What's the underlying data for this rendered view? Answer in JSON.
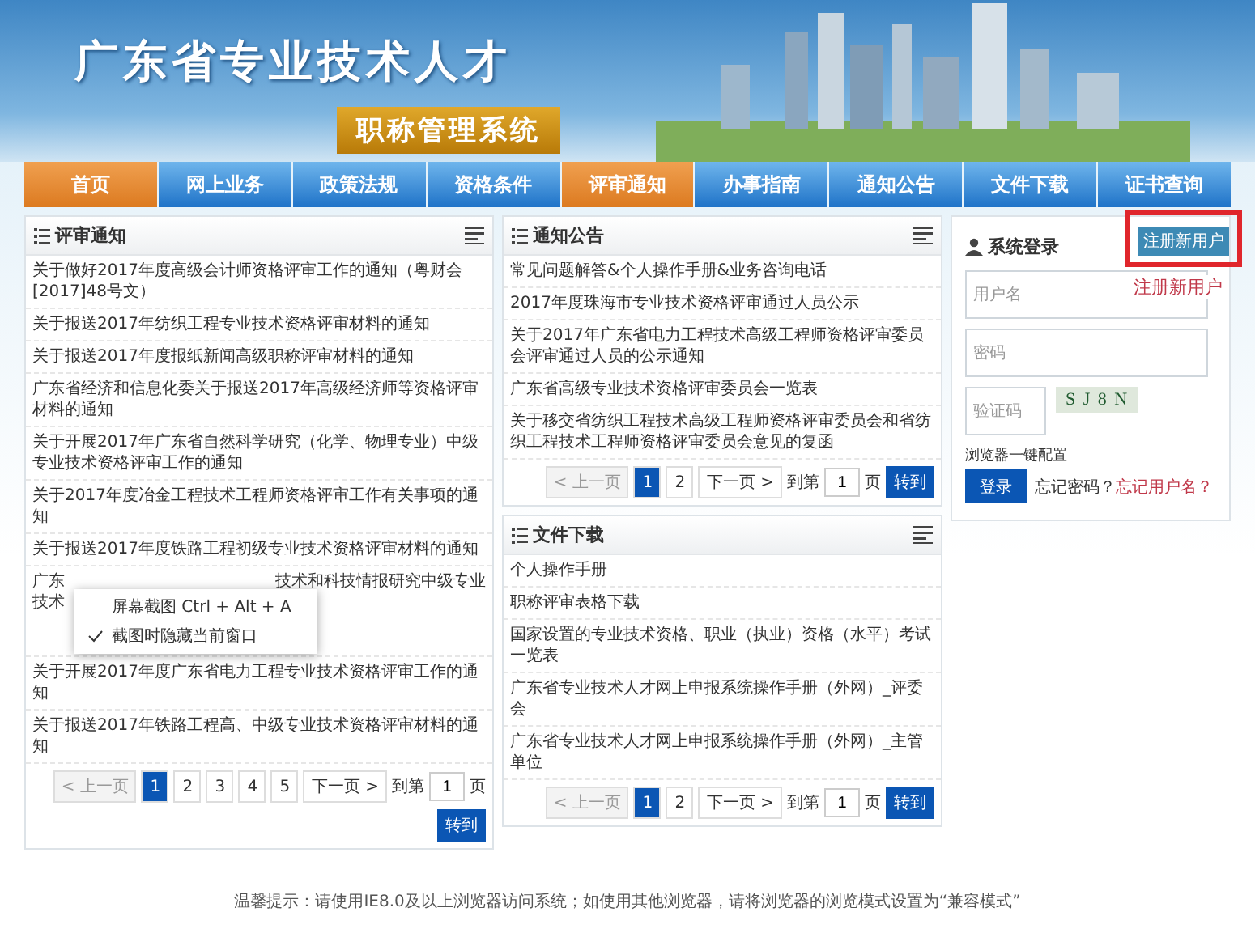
{
  "header": {
    "title": "广东省专业技术人才",
    "subtitle": "职称管理系统"
  },
  "nav": [
    {
      "label": "首页",
      "selected": true
    },
    {
      "label": "网上业务",
      "selected": false
    },
    {
      "label": "政策法规",
      "selected": false
    },
    {
      "label": "资格条件",
      "selected": false
    },
    {
      "label": "评审通知",
      "selected": true
    },
    {
      "label": "办事指南",
      "selected": false
    },
    {
      "label": "通知公告",
      "selected": false
    },
    {
      "label": "文件下载",
      "selected": false
    },
    {
      "label": "证书查询",
      "selected": false
    }
  ],
  "review_notices": {
    "title": "评审通知",
    "items": [
      {
        "kind": "full",
        "text": "关于做好2017年度高级会计师资格评审工作的通知（粤财会[2017]48号文）"
      },
      {
        "kind": "full",
        "text": "关于报送2017年纺织工程专业技术资格评审材料的通知"
      },
      {
        "kind": "full",
        "text": "关于报送2017年度报纸新闻高级职称评审材料的通知"
      },
      {
        "kind": "full",
        "text": "广东省经济和信息化委关于报送2017年高级经济师等资格评审材料的通知"
      },
      {
        "kind": "full",
        "text": "关于开展2017年广东省自然科学研究（化学、物理专业）中级专业技术资格评审工作的通知"
      },
      {
        "kind": "full",
        "text": "关于2017年度冶金工程技术工程师资格评审工作有关事项的通知"
      },
      {
        "kind": "full",
        "text": "关于报送2017年度铁路工程初级专业技术资格评审材料的通知"
      },
      {
        "kind": "covered",
        "lines": [
          {
            "left": "广东",
            "right": "技术和科技情报研究中级专业"
          },
          {
            "left": "技术"
          }
        ]
      },
      {
        "kind": "full",
        "text": "关于开展2017年度广东省电力工程专业技术资格评审工作的通知"
      },
      {
        "kind": "full",
        "text": "关于报送2017年铁路工程高、中级专业技术资格评审材料的通知"
      }
    ],
    "pager": {
      "prev": "< 上一页",
      "pages": [
        {
          "label": "1",
          "selected": true
        },
        {
          "label": "2",
          "selected": false
        },
        {
          "label": "3",
          "selected": false
        },
        {
          "label": "4",
          "selected": false
        },
        {
          "label": "5",
          "selected": false
        }
      ],
      "next": "下一页 >",
      "goto_label": "到第",
      "page_value": "1",
      "page_unit": "页",
      "goto_button": "转到"
    }
  },
  "context_menu": [
    {
      "label": "屏幕截图 Ctrl + Alt + A",
      "checked": false
    },
    {
      "label": "截图时隐藏当前窗口",
      "checked": true
    }
  ],
  "announcements": {
    "title": "通知公告",
    "items": [
      {
        "kind": "full",
        "text": "常见问题解答&个人操作手册&业务咨询电话"
      },
      {
        "kind": "full",
        "text": "2017年度珠海市专业技术资格评审通过人员公示"
      },
      {
        "kind": "full",
        "text": "关于2017年广东省电力工程技术高级工程师资格评审委员会评审通过人员的公示通知"
      },
      {
        "kind": "full",
        "text": "广东省高级专业技术资格评审委员会一览表"
      },
      {
        "kind": "full",
        "text": "关于移交省纺织工程技术高级工程师资格评审委员会和省纺织工程技术工程师资格评审委员会意见的复函"
      }
    ],
    "pager": {
      "prev": "< 上一页",
      "pages": [
        {
          "label": "1",
          "selected": true
        },
        {
          "label": "2",
          "selected": false
        }
      ],
      "next": "下一页 >",
      "goto_label": "到第",
      "page_value": "1",
      "page_unit": "页",
      "goto_button": "转到"
    }
  },
  "downloads": {
    "title": "文件下载",
    "items": [
      {
        "kind": "full",
        "text": "个人操作手册"
      },
      {
        "kind": "full",
        "text": "职称评审表格下载"
      },
      {
        "kind": "full",
        "text": "国家设置的专业技术资格、职业（执业）资格（水平）考试一览表"
      },
      {
        "kind": "full",
        "text": "广东省专业技术人才网上申报系统操作手册（外网）_评委会"
      },
      {
        "kind": "full",
        "text": "广东省专业技术人才网上申报系统操作手册（外网）_主管单位"
      }
    ],
    "pager": {
      "prev": "< 上一页",
      "pages": [
        {
          "label": "1",
          "selected": true
        },
        {
          "label": "2",
          "selected": false
        }
      ],
      "next": "下一页 >",
      "goto_label": "到第",
      "page_value": "1",
      "page_unit": "页",
      "goto_button": "转到"
    }
  },
  "login": {
    "title": "系统登录",
    "register_button": "注册新用户",
    "annotation": "注册新用户",
    "username": {
      "placeholder": "用户名"
    },
    "password": {
      "placeholder": "密码"
    },
    "captcha": {
      "placeholder": "验证码"
    },
    "captcha_code": "S J 8 N",
    "browser_config": "浏览器一键配置",
    "login_button": "登录",
    "forgot_password": "忘记密码？",
    "forgot_username": "忘记用户名？"
  },
  "footer": "温馨提示：请使用IE8.0及以上浏览器访问系统；如使用其他浏览器，请将浏览器的浏览模式设置为“兼容模式”"
}
